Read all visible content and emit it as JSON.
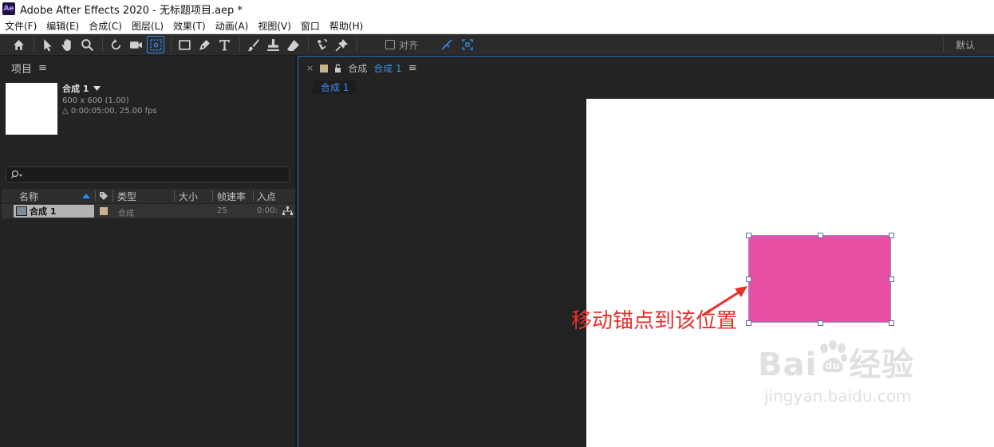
{
  "window": {
    "title": "Adobe After Effects 2020 - 无标题项目.aep *",
    "logo": "Ae"
  },
  "menu": [
    "文件(F)",
    "编辑(E)",
    "合成(C)",
    "图层(L)",
    "效果(T)",
    "动画(A)",
    "视图(V)",
    "窗口",
    "帮助(H)"
  ],
  "toolbar": {
    "tools": [
      "home-icon",
      "selection-icon",
      "hand-icon",
      "zoom-icon",
      "rotate-icon",
      "camera-icon",
      "pan-behind-icon",
      "rectangle-icon",
      "pen-icon",
      "text-icon",
      "brush-icon",
      "clone-stamp-icon",
      "eraser-icon",
      "roto-brush-icon",
      "puppet-pin-icon"
    ],
    "active_tool": "pan-behind-icon",
    "align_label": "对齐",
    "workspace": "默认"
  },
  "project_panel": {
    "tab_label": "项目",
    "selected_comp": {
      "name": "合成 1",
      "resolution": "600 x 600 (1.00)",
      "duration": "△ 0:00:05:00, 25.00 fps"
    },
    "columns": [
      "名称",
      "类型",
      "大小",
      "帧速率",
      "入点"
    ],
    "rows": [
      {
        "name": "合成 1",
        "type": "合成",
        "size": "",
        "fps": "25",
        "in_point": "0:00:"
      }
    ]
  },
  "composition_panel": {
    "tab_prefix": "合成",
    "tab_comp": "合成 1",
    "breadcrumb": "合成 1",
    "layer_color": "#e84ea2",
    "annotation": "移动锚点到该位置"
  },
  "watermark": {
    "brand_left": "Bai",
    "brand_du": "du",
    "brand_right": "经验",
    "url": "jingyan.baidu.com"
  },
  "colors": {
    "accent": "#2d8ceb",
    "annotation_red": "#e8302c"
  }
}
